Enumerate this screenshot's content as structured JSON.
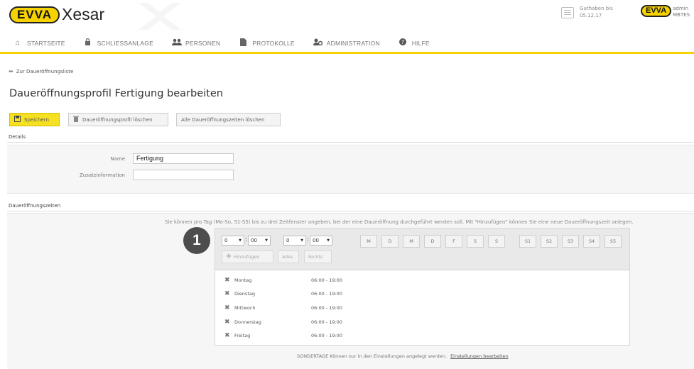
{
  "header": {
    "brand": "EVVA",
    "product": "Xesar",
    "credit": {
      "label": "Guthaben bis",
      "date": "05.12.17",
      "icon": "credit-card-icon"
    },
    "user": {
      "brand": "EVVA",
      "name": "admin",
      "org": "MBTES"
    }
  },
  "nav": [
    {
      "label": "STARTSEITE",
      "icon": "home-icon"
    },
    {
      "label": "SCHLIESSANLAGE",
      "icon": "lock-icon"
    },
    {
      "label": "PERSONEN",
      "icon": "people-icon"
    },
    {
      "label": "PROTOKOLLE",
      "icon": "document-icon"
    },
    {
      "label": "ADMINISTRATION",
      "icon": "admin-icon"
    },
    {
      "label": "HILFE",
      "icon": "help-icon"
    }
  ],
  "back_link": "Zur Daueröffnungsliste",
  "page_title": "Daueröffnungsprofil Fertigung bearbeiten",
  "toolbar": {
    "save": "Speichern",
    "delete_profile": "Daueröffnungsprofil löschen",
    "delete_times": "Alle Daueröffnungszeiten löschen"
  },
  "details": {
    "section": "Details",
    "name_label": "Name",
    "name_value": "Fertigung",
    "info_label": "Zusatzinformation",
    "info_value": ""
  },
  "times": {
    "section": "Daueröffnungszeiten",
    "hint": "Sie können pro Tag (Mo-So, S1-S5) bis zu drei Zeitfenster angeben, bei der eine Daueröffnung durchgeführt werden soll. Mit \"Hinzufügen\" können Sie eine neue Daueröffnungszeit anlegen.",
    "from_hour": "0",
    "from_min": "00",
    "to_hour": "0",
    "to_min": "00",
    "days": [
      "M",
      "D",
      "M",
      "D",
      "F",
      "S",
      "S"
    ],
    "special_days": [
      "S1",
      "S2",
      "S3",
      "S4",
      "S5"
    ],
    "add_button": "Hinzufügen",
    "all_button": "Alles",
    "none_button": "Nichts",
    "entries": [
      {
        "day": "Montag",
        "time": "06:00 - 19:00"
      },
      {
        "day": "Dienstag",
        "time": "06:00 - 19:00"
      },
      {
        "day": "Mittwoch",
        "time": "06:00 - 19:00"
      },
      {
        "day": "Donnerstag",
        "time": "06:00 - 19:00"
      },
      {
        "day": "Freitag",
        "time": "06:00 - 19:00"
      }
    ],
    "footer": "SONDERTAGE Können nur in den Einstellungen angelegt werden.",
    "footer_link": "Einstellungen bearbeiten"
  },
  "callout": "1",
  "colors": {
    "accent": "#f5d200",
    "badge": "#4d4d4d"
  }
}
